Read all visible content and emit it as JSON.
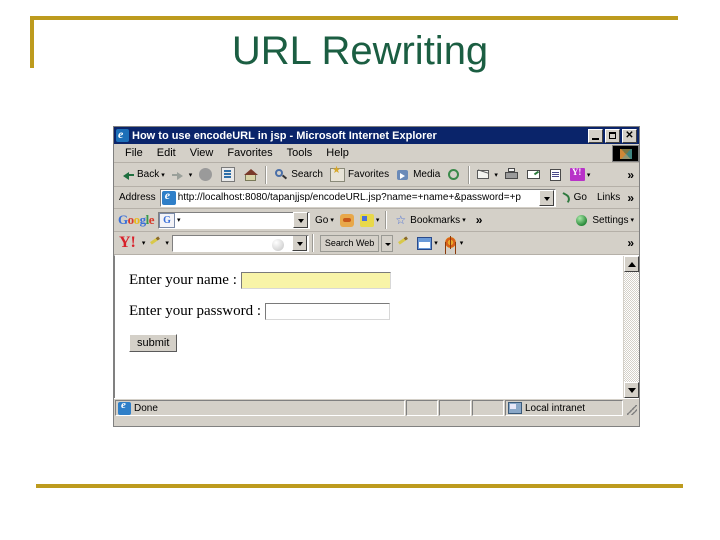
{
  "slide": {
    "title": "URL Rewriting",
    "title_color": "#1b5e42",
    "rule_color": "#bd9b1e"
  },
  "browser": {
    "window_title": "How to use encodeURL in jsp - Microsoft Internet Explorer",
    "window_buttons": {
      "minimize": "_",
      "maximize": "□",
      "close": "✕"
    },
    "menu": [
      {
        "label": "File"
      },
      {
        "label": "Edit"
      },
      {
        "label": "View"
      },
      {
        "label": "Favorites"
      },
      {
        "label": "Tools"
      },
      {
        "label": "Help"
      }
    ],
    "toolbar": {
      "back_label": "Back",
      "search_label": "Search",
      "favorites_label": "Favorites",
      "media_label": "Media",
      "overflow": "»"
    },
    "address_bar": {
      "label": "Address",
      "url": "http://localhost:8080/tapanjjsp/encodeURL.jsp?name=+name+&password=+p",
      "go_label": "Go",
      "links_label": "Links",
      "overflow": "»"
    },
    "google_toolbar": {
      "logo": {
        "g1": "G",
        "o1": "o",
        "o2": "o",
        "g2": "g",
        "l": "l",
        "e": "e"
      },
      "badge": "G",
      "search_value": "",
      "go_label": "Go",
      "bookmarks_label": "Bookmarks",
      "overflow": "»",
      "settings_label": "Settings",
      "caret": "▾"
    },
    "yahoo_toolbar": {
      "logo": "Y!",
      "search_value": "",
      "search_button_label": "Search Web",
      "overflow": "»",
      "caret": "▾"
    },
    "page": {
      "name_label": "Enter your name :",
      "name_value": "",
      "password_label": "Enter your password :",
      "password_value": "",
      "submit_label": "submit",
      "name_field_color": "#f8f4a8"
    },
    "status_bar": {
      "message": "Done",
      "zone": "Local intranet"
    }
  }
}
